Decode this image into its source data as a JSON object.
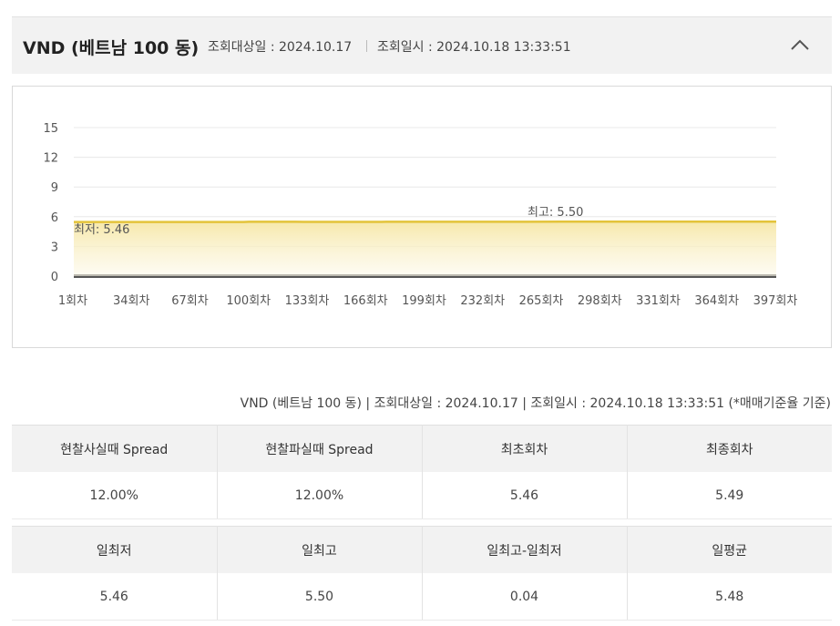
{
  "header": {
    "currency": "VND (베트남 100 동)",
    "query_date": "조회대상일 : 2024.10.17",
    "query_time": "조회일시 : 2024.10.18 13:33:51",
    "collapse_icon": "chevron-up-icon"
  },
  "chart_data": {
    "type": "area",
    "ylim": [
      0,
      15
    ],
    "yticks": [
      "0",
      "3",
      "6",
      "9",
      "12",
      "15"
    ],
    "xticks": [
      "1회차",
      "34회차",
      "67회차",
      "100회차",
      "133회차",
      "166회차",
      "199회차",
      "232회차",
      "265회차",
      "298회차",
      "331회차",
      "364회차",
      "397회차"
    ],
    "x_range": [
      1,
      410
    ],
    "series": [
      {
        "color": "#e3c33a",
        "points": [
          [
            1,
            5.46
          ],
          [
            100,
            5.46
          ],
          [
            103,
            5.49
          ],
          [
            130,
            5.49
          ],
          [
            135,
            5.47
          ],
          [
            165,
            5.47
          ],
          [
            168,
            5.48
          ],
          [
            180,
            5.47
          ],
          [
            183,
            5.49
          ],
          [
            265,
            5.49
          ],
          [
            285,
            5.5
          ],
          [
            410,
            5.5
          ]
        ]
      }
    ],
    "annotations": {
      "min_label": "최저: 5.46",
      "max_label": "최고: 5.50"
    }
  },
  "caption": "VND (베트남 100 동) | 조회대상일 : 2024.10.17 | 조회일시 : 2024.10.18 13:33:51 (*매매기준율 기준)",
  "table": {
    "row1_headers": [
      "현찰사실때 Spread",
      "현찰파실때 Spread",
      "최초회차",
      "최종회차"
    ],
    "row1_values": [
      "12.00%",
      "12.00%",
      "5.46",
      "5.49"
    ],
    "row2_headers": [
      "일최저",
      "일최고",
      "일최고-일최저",
      "일평균"
    ],
    "row2_values": [
      "5.46",
      "5.50",
      "0.04",
      "5.48"
    ]
  }
}
